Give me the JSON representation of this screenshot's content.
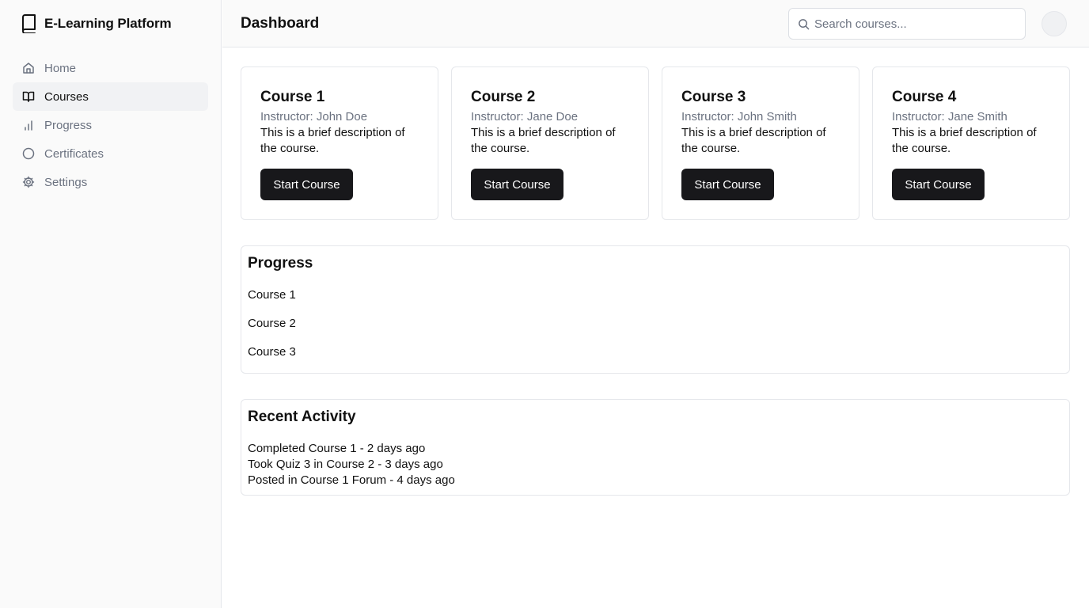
{
  "app": {
    "name": "E-Learning Platform"
  },
  "sidebar": {
    "items": [
      {
        "label": "Home",
        "icon": "home-icon",
        "active": false
      },
      {
        "label": "Courses",
        "icon": "book-open-icon",
        "active": true
      },
      {
        "label": "Progress",
        "icon": "bar-chart-icon",
        "active": false
      },
      {
        "label": "Certificates",
        "icon": "circle-icon",
        "active": false
      },
      {
        "label": "Settings",
        "icon": "gear-icon",
        "active": false
      }
    ]
  },
  "header": {
    "title": "Dashboard",
    "search_placeholder": "Search courses..."
  },
  "courses": [
    {
      "title": "Course 1",
      "instructor": "Instructor: John Doe",
      "description": "This is a brief description of the course.",
      "button": "Start Course"
    },
    {
      "title": "Course 2",
      "instructor": "Instructor: Jane Doe",
      "description": "This is a brief description of the course.",
      "button": "Start Course"
    },
    {
      "title": "Course 3",
      "instructor": "Instructor: John Smith",
      "description": "This is a brief description of the course.",
      "button": "Start Course"
    },
    {
      "title": "Course 4",
      "instructor": "Instructor: Jane Smith",
      "description": "This is a brief description of the course.",
      "button": "Start Course"
    }
  ],
  "progress": {
    "title": "Progress",
    "items": [
      "Course 1",
      "Course 2",
      "Course 3"
    ]
  },
  "activity": {
    "title": "Recent Activity",
    "items": [
      "Completed Course 1 - 2 days ago",
      "Took Quiz 3 in Course 2 - 3 days ago",
      "Posted in Course 1 Forum - 4 days ago"
    ]
  },
  "colors": {
    "sidebar_bg": "#fafafa",
    "active_item_bg": "#f1f2f4",
    "button_bg": "#18181b",
    "muted_text": "#6b7280",
    "border": "#e5e7eb"
  }
}
